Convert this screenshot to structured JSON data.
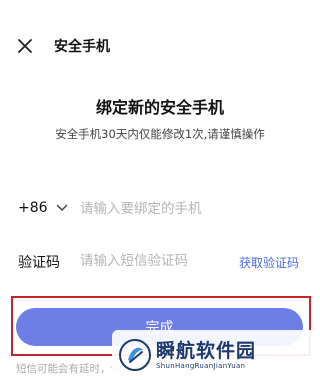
{
  "header": {
    "title": "安全手机",
    "close_icon": "close-icon"
  },
  "main": {
    "heading": "绑定新的安全手机",
    "subtext": "安全手机30天内仅能修改1次,请谨慎操作"
  },
  "phone": {
    "country_code": "+86",
    "dropdown_icon": "chevron-down-icon",
    "placeholder": "请输入要绑定的手机",
    "value": ""
  },
  "code": {
    "label": "验证码",
    "placeholder": "请输入短信验证码",
    "value": "",
    "get_code_label": "获取验证码"
  },
  "actions": {
    "done_label": "完成"
  },
  "footer": {
    "hint": "短信可能会有延时，请"
  },
  "watermark": {
    "brand": "瞬航软件园",
    "sub": "ShunHangRuanJianYuan"
  },
  "colors": {
    "accent": "#6d7ee6",
    "link": "#4a6bd8",
    "highlight": "#c0262c",
    "placeholder": "#b5b5b5"
  }
}
